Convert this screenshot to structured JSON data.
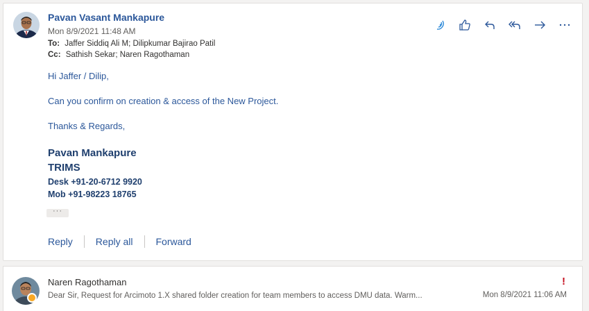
{
  "message": {
    "sender": "Pavan Vasant Mankapure",
    "date": "Mon 8/9/2021 11:48 AM",
    "to_label": "To:",
    "to": "Jaffer Siddiq Ali M; Dilipkumar Bajirao Patil",
    "cc_label": "Cc:",
    "cc": "Sathish Sekar; Naren Ragothaman",
    "body": {
      "greeting": "Hi Jaffer / Dilip,",
      "line1": "Can you confirm on creation & access of the New Project.",
      "closing": "Thanks & Regards,"
    },
    "signature": {
      "name": "Pavan Mankapure",
      "company": "TRIMS",
      "desk": "Desk +91-20-6712 9920",
      "mob": "Mob +91-98223 18765"
    },
    "expand_label": "···",
    "actions": {
      "reply": "Reply",
      "reply_all": "Reply all",
      "forward": "Forward"
    }
  },
  "toolbar": {
    "icons": [
      "immersive-reader-icon",
      "like-icon",
      "reply-icon",
      "reply-all-icon",
      "forward-icon",
      "more-icon"
    ]
  },
  "collapsed": {
    "sender": "Naren Ragothaman",
    "preview": "Dear Sir, Request for Arcimoto 1.X shared folder creation for team members to access DMU data. Warm...",
    "date": "Mon 8/9/2021 11:06 AM",
    "importance": "!"
  },
  "colors": {
    "accent": "#2b579a",
    "signature": "#1f3f6e",
    "importance": "#c50f1f",
    "presence_away": "#f8a825"
  }
}
